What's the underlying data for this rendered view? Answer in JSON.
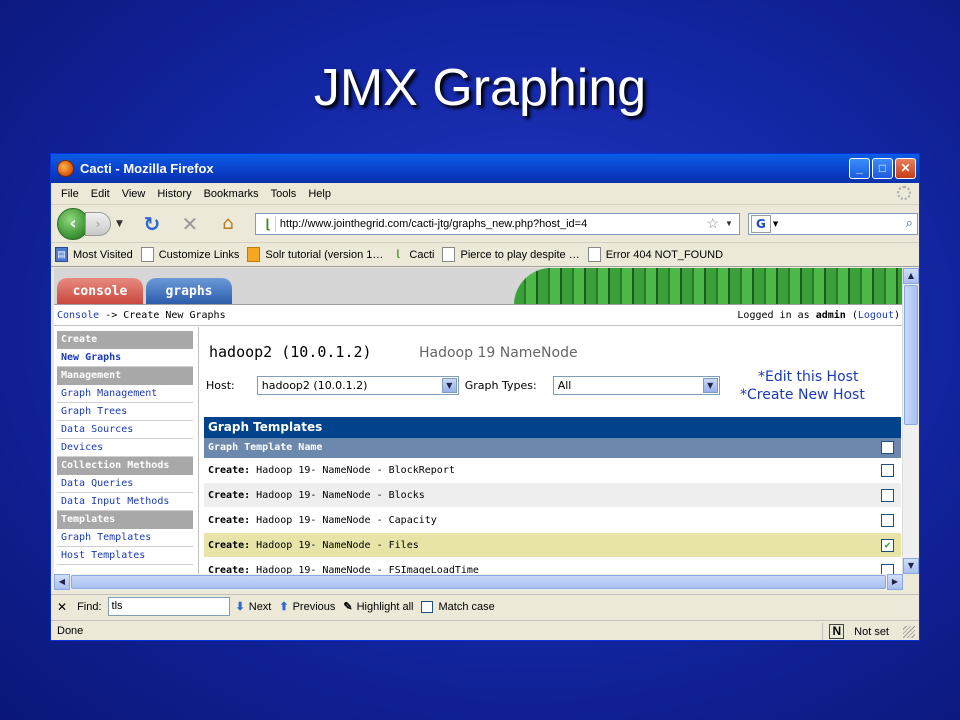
{
  "slide_title": "JMX Graphing",
  "window": {
    "title": "Cacti - Mozilla Firefox"
  },
  "menu": [
    "File",
    "Edit",
    "View",
    "History",
    "Bookmarks",
    "Tools",
    "Help"
  ],
  "url": "http://www.jointhegrid.com/cacti-jtg/graphs_new.php?host_id=4",
  "bookmarks": [
    "Most Visited",
    "Customize Links",
    "Solr tutorial (version 1…",
    "Cacti",
    "Pierce to play despite …",
    "Error 404 NOT_FOUND"
  ],
  "tabs": {
    "console": "console",
    "graphs": "graphs"
  },
  "breadcrumb": {
    "console": "Console",
    "sep": " -> ",
    "current": "Create New Graphs"
  },
  "login": {
    "prefix": "Logged in as ",
    "user": "admin",
    "logout": "Logout"
  },
  "nav": {
    "create_header": "Create",
    "new_graphs": "New Graphs",
    "management_header": "Management",
    "graph_management": "Graph Management",
    "graph_trees": "Graph Trees",
    "data_sources": "Data Sources",
    "devices": "Devices",
    "collection_header": "Collection Methods",
    "data_queries": "Data Queries",
    "data_input_methods": "Data Input Methods",
    "templates_header": "Templates",
    "graph_templates": "Graph Templates",
    "host_templates": "Host Templates"
  },
  "host": {
    "name": "hadoop2 (10.0.1.2)",
    "description": "Hadoop 19 NameNode"
  },
  "filter": {
    "host_label": "Host:",
    "host_value": "hadoop2 (10.0.1.2)",
    "graph_types_label": "Graph Types:",
    "graph_types_value": "All"
  },
  "links": {
    "edit_host": "Edit this Host",
    "create_host": "Create New Host",
    "asterisk": "*"
  },
  "graph_templates": {
    "title": "Graph Templates",
    "column": "Graph Template Name",
    "create_prefix": "Create:",
    "rows": [
      {
        "name": " Hadoop 19- NameNode - BlockReport",
        "checked": false
      },
      {
        "name": " Hadoop 19- NameNode - Blocks",
        "checked": false
      },
      {
        "name": " Hadoop 19- NameNode - Capacity",
        "checked": false
      },
      {
        "name": " Hadoop 19- NameNode - Files",
        "checked": true
      },
      {
        "name": " Hadoop 19- NameNode - FSImageLoadTime",
        "checked": false
      }
    ]
  },
  "findbar": {
    "label": "Find:",
    "value": "tls",
    "next": "Next",
    "previous": "Previous",
    "highlight": "Highlight all",
    "match_case": "Match case"
  },
  "status": {
    "text": "Done",
    "right": "Not set"
  },
  "colors": {
    "slide_bg": "#1428a8",
    "table_header": "#00438c",
    "column_header": "#6d88ad",
    "highlight_row": "#e8e4a8"
  }
}
